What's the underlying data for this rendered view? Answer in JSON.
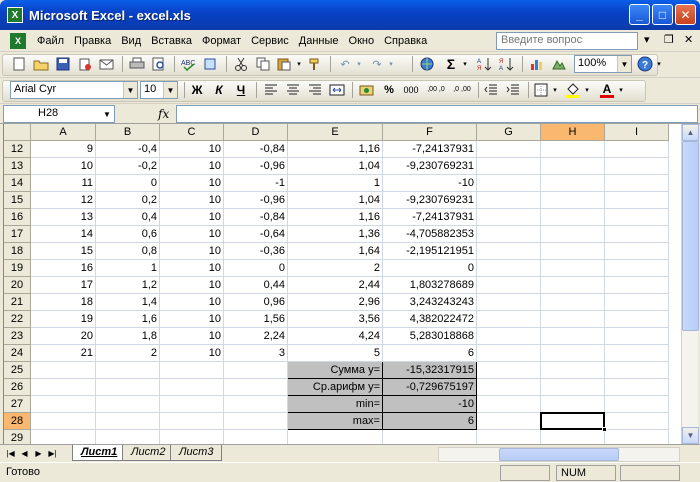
{
  "window": {
    "title": "Microsoft Excel - excel.xls",
    "app_icon": "X"
  },
  "menu": {
    "items": [
      "Файл",
      "Правка",
      "Вид",
      "Вставка",
      "Формат",
      "Сервис",
      "Данные",
      "Окно",
      "Справка"
    ],
    "help_placeholder": "Введите вопрос"
  },
  "toolbar": {
    "zoom": "100%",
    "font_name": "Arial Cyr",
    "font_size": "10",
    "bold": "Ж",
    "italic": "К",
    "underline": "Ч",
    "percent": "%",
    "thousands": "000",
    "dec_inc": ",00 ,0",
    "dec_dec": ",0 ,00",
    "sum": "Σ",
    "font_color_letter": "A"
  },
  "formula_bar": {
    "name_box": "H28",
    "fx": "fx",
    "content": ""
  },
  "columns": [
    "A",
    "B",
    "C",
    "D",
    "E",
    "F",
    "G",
    "H",
    "I"
  ],
  "active_column": "H",
  "active_row": "28",
  "rows": [
    {
      "n": "12",
      "cells": [
        "9",
        "-0,4",
        "10",
        "-0,84",
        "1,16",
        "-7,24137931",
        "",
        "",
        ""
      ]
    },
    {
      "n": "13",
      "cells": [
        "10",
        "-0,2",
        "10",
        "-0,96",
        "1,04",
        "-9,230769231",
        "",
        "",
        ""
      ]
    },
    {
      "n": "14",
      "cells": [
        "11",
        "0",
        "10",
        "-1",
        "1",
        "-10",
        "",
        "",
        ""
      ]
    },
    {
      "n": "15",
      "cells": [
        "12",
        "0,2",
        "10",
        "-0,96",
        "1,04",
        "-9,230769231",
        "",
        "",
        ""
      ]
    },
    {
      "n": "16",
      "cells": [
        "13",
        "0,4",
        "10",
        "-0,84",
        "1,16",
        "-7,24137931",
        "",
        "",
        ""
      ]
    },
    {
      "n": "17",
      "cells": [
        "14",
        "0,6",
        "10",
        "-0,64",
        "1,36",
        "-4,705882353",
        "",
        "",
        ""
      ]
    },
    {
      "n": "18",
      "cells": [
        "15",
        "0,8",
        "10",
        "-0,36",
        "1,64",
        "-2,195121951",
        "",
        "",
        ""
      ]
    },
    {
      "n": "19",
      "cells": [
        "16",
        "1",
        "10",
        "0",
        "2",
        "0",
        "",
        "",
        ""
      ]
    },
    {
      "n": "20",
      "cells": [
        "17",
        "1,2",
        "10",
        "0,44",
        "2,44",
        "1,803278689",
        "",
        "",
        ""
      ]
    },
    {
      "n": "21",
      "cells": [
        "18",
        "1,4",
        "10",
        "0,96",
        "2,96",
        "3,243243243",
        "",
        "",
        ""
      ]
    },
    {
      "n": "22",
      "cells": [
        "19",
        "1,6",
        "10",
        "1,56",
        "3,56",
        "4,382022472",
        "",
        "",
        ""
      ]
    },
    {
      "n": "23",
      "cells": [
        "20",
        "1,8",
        "10",
        "2,24",
        "4,24",
        "5,283018868",
        "",
        "",
        ""
      ]
    },
    {
      "n": "24",
      "cells": [
        "21",
        "2",
        "10",
        "3",
        "5",
        "6",
        "",
        "",
        ""
      ]
    },
    {
      "n": "25",
      "cells": [
        "",
        "",
        "",
        "",
        "Сумма y=",
        "-15,32317915",
        "",
        "",
        ""
      ]
    },
    {
      "n": "26",
      "cells": [
        "",
        "",
        "",
        "",
        "Ср.арифм y=",
        "-0,729675197",
        "",
        "",
        ""
      ]
    },
    {
      "n": "27",
      "cells": [
        "",
        "",
        "",
        "",
        "min=",
        "-10",
        "",
        "",
        ""
      ]
    },
    {
      "n": "28",
      "cells": [
        "",
        "",
        "",
        "",
        "max=",
        "6",
        "",
        "",
        ""
      ]
    },
    {
      "n": "29",
      "cells": [
        "",
        "",
        "",
        "",
        "",
        "",
        "",
        "",
        ""
      ]
    }
  ],
  "sheets": [
    "Лист1",
    "Лист2",
    "Лист3"
  ],
  "active_sheet": "Лист1",
  "status": {
    "text": "Готово",
    "num": "NUM"
  }
}
